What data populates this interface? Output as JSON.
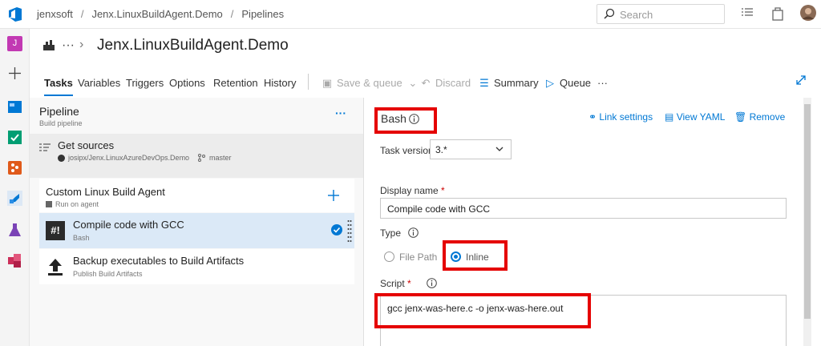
{
  "breadcrumbs": [
    "jenxsoft",
    "Jenx.LinuxBuildAgent.Demo",
    "Pipelines"
  ],
  "search_placeholder": "Search",
  "title": "Jenx.LinuxBuildAgent.Demo",
  "ellipsis": "···",
  "rail_avatar": "J",
  "tabs": [
    "Tasks",
    "Variables",
    "Triggers",
    "Options",
    "Retention",
    "History"
  ],
  "actions": {
    "save_queue": "Save & queue",
    "discard": "Discard",
    "summary": "Summary",
    "queue": "Queue",
    "more": "···"
  },
  "pipeline": {
    "title": "Pipeline",
    "subtitle": "Build pipeline",
    "more": "···"
  },
  "get_sources": {
    "title": "Get sources",
    "repo": "josipx/Jenx.LinuxAzureDevOps.Demo",
    "branch": "master"
  },
  "agent_job": {
    "title": "Custom Linux Build Agent",
    "subtitle": "Run on agent"
  },
  "tasks": [
    {
      "title": "Compile code with GCC",
      "subtitle": "Bash"
    },
    {
      "title": "Backup executables to Build Artifacts",
      "subtitle": "Publish Build Artifacts"
    }
  ],
  "task_icon_text": "#!",
  "detail": {
    "heading": "Bash",
    "link_settings": "Link settings",
    "view_yaml": "View YAML",
    "remove": "Remove",
    "task_version_label": "Task version",
    "task_version_value": "3.*",
    "display_name_label": "Display name",
    "required_mark": "*",
    "display_name_value": "Compile code with GCC",
    "type_label": "Type",
    "type_options": [
      "File Path",
      "Inline"
    ],
    "type_selected": "Inline",
    "script_label": "Script",
    "script_value": "gcc jenx-was-here.c -o jenx-was-here.out"
  },
  "colors": {
    "accent": "#0078d4",
    "highlight": "#e50000",
    "selected_row": "#dbe9f7"
  }
}
